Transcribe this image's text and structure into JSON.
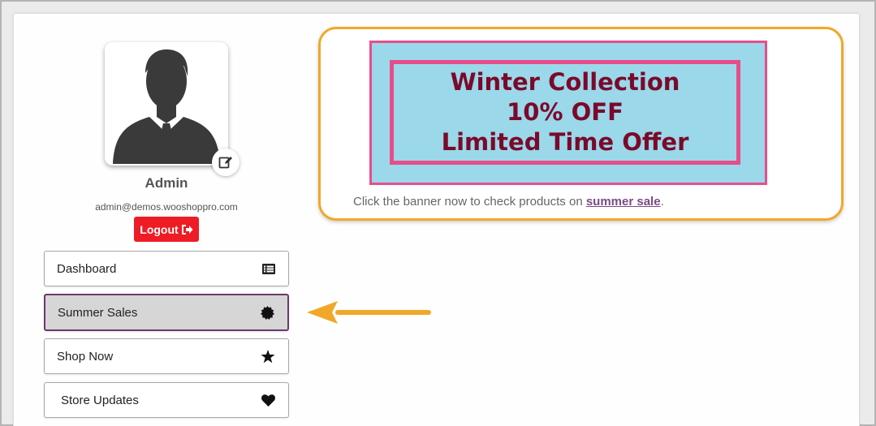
{
  "profile": {
    "name": "Admin",
    "email": "admin@demos.wooshoppro.com",
    "logout_label": "Logout",
    "avatar_icon": "user-silhouette-icon",
    "edit_icon": "pencil-icon"
  },
  "menu": {
    "items": [
      {
        "label": "Dashboard",
        "icon": "list-icon",
        "active": false
      },
      {
        "label": "Summer Sales",
        "icon": "badge-icon",
        "active": true
      },
      {
        "label": "Shop Now",
        "icon": "star-icon",
        "active": false
      },
      {
        "label": "Store Updates",
        "icon": "heart-icon",
        "active": false
      }
    ]
  },
  "promo": {
    "banner_line1": "Winter Collection",
    "banner_line2": "10% OFF",
    "banner_line3": "Limited Time Offer",
    "text_prefix": "Click the banner now to check products on ",
    "link_text": "summer sale",
    "text_suffix": "."
  },
  "colors": {
    "accent_orange": "#f1a828",
    "banner_bg": "#9ad8ea",
    "banner_border": "#e84d8a",
    "banner_text": "#7a0a2a",
    "logout_red": "#ee1c25",
    "link_purple": "#7b4a87"
  }
}
